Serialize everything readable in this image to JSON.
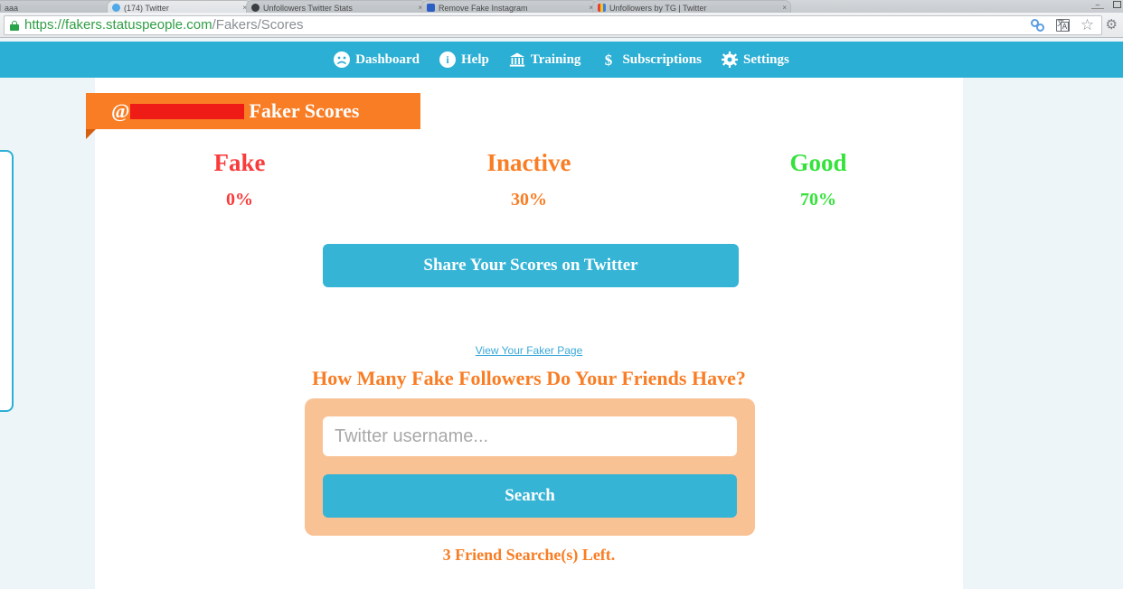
{
  "browser": {
    "tabs": [
      {
        "title": "aaa",
        "favicon": "fav-grey",
        "close": "×",
        "active": false
      },
      {
        "title": "(174) Twitter",
        "favicon": "fav-bird",
        "close": "×",
        "active": true
      },
      {
        "title": "Unfollowers Twitter Stats",
        "favicon": "fav-dark",
        "close": "×",
        "active": false
      },
      {
        "title": "Remove Fake Instagram",
        "favicon": "fav-blue",
        "close": "×",
        "active": false
      },
      {
        "title": "Unfollowers by TG | Twitter",
        "favicon": "fav-multi",
        "close": "×",
        "active": false
      }
    ],
    "window_controls": {
      "minimize": "–",
      "maximize": "□"
    },
    "url": {
      "scheme": "https://",
      "host": "fakers.statuspeople.com",
      "path": "/Fakers/Scores",
      "full": "https://fakers.statuspeople.com/Fakers/Scores"
    },
    "omnibox_icons": {
      "link": "chain-icon",
      "translate": "translate-icon",
      "bookmark": "☆",
      "settings": "⚙"
    }
  },
  "nav": {
    "items": [
      {
        "label": "Dashboard",
        "icon": "sad-face-icon"
      },
      {
        "label": "Help",
        "icon": "info-icon"
      },
      {
        "label": "Training",
        "icon": "bank-icon"
      },
      {
        "label": "Subscriptions",
        "icon": "dollar-icon"
      },
      {
        "label": "Settings",
        "icon": "gear-icon"
      }
    ]
  },
  "banner": {
    "at_symbol": "@",
    "username_redacted": "",
    "title": "Faker Scores"
  },
  "scores": [
    {
      "label": "Fake",
      "value": "0%",
      "color": "#f93b3b"
    },
    {
      "label": "Inactive",
      "value": "30%",
      "color": "#f97d24"
    },
    {
      "label": "Good",
      "value": "70%",
      "color": "#35e23b"
    }
  ],
  "share": {
    "label": "Share Your Scores on Twitter"
  },
  "faker_page_link": "View Your Faker Page",
  "friends_heading": "How Many Fake Followers Do Your Friends Have?",
  "search": {
    "placeholder": "Twitter username...",
    "value": "",
    "button_label": "Search"
  },
  "searches_left": "3 Friend Searche(s) Left.",
  "colors": {
    "nav_teal": "#2cafd4",
    "button_teal": "#35b4d6",
    "orange": "#f97d24",
    "orange_card": "#f9c295",
    "red": "#f93b3b",
    "green": "#35e23b",
    "page_bg": "#eef5f9",
    "redaction": "#ee1b17"
  }
}
